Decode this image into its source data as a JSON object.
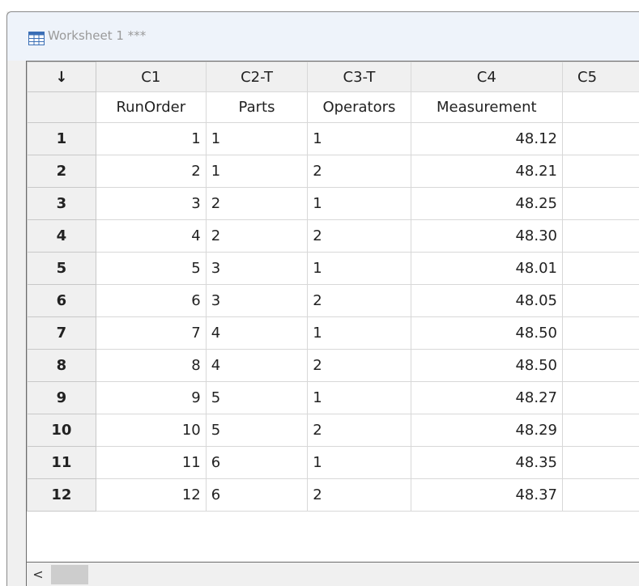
{
  "window": {
    "title": "Worksheet 1 ***"
  },
  "columns": [
    {
      "id": "C1",
      "name": "RunOrder"
    },
    {
      "id": "C2-T",
      "name": "Parts"
    },
    {
      "id": "C3-T",
      "name": "Operators"
    },
    {
      "id": "C4",
      "name": "Measurement"
    },
    {
      "id": "C5",
      "name": ""
    }
  ],
  "corner_icon": "down-arrow-icon",
  "corner_glyph": "↓",
  "rows": [
    {
      "n": "1",
      "run": "1",
      "part": "1",
      "op": "1",
      "meas": "48.12"
    },
    {
      "n": "2",
      "run": "2",
      "part": "1",
      "op": "2",
      "meas": "48.21"
    },
    {
      "n": "3",
      "run": "3",
      "part": "2",
      "op": "1",
      "meas": "48.25"
    },
    {
      "n": "4",
      "run": "4",
      "part": "2",
      "op": "2",
      "meas": "48.30"
    },
    {
      "n": "5",
      "run": "5",
      "part": "3",
      "op": "1",
      "meas": "48.01"
    },
    {
      "n": "6",
      "run": "6",
      "part": "3",
      "op": "2",
      "meas": "48.05"
    },
    {
      "n": "7",
      "run": "7",
      "part": "4",
      "op": "1",
      "meas": "48.50"
    },
    {
      "n": "8",
      "run": "8",
      "part": "4",
      "op": "2",
      "meas": "48.50"
    },
    {
      "n": "9",
      "run": "9",
      "part": "5",
      "op": "1",
      "meas": "48.27"
    },
    {
      "n": "10",
      "run": "10",
      "part": "5",
      "op": "2",
      "meas": "48.29"
    },
    {
      "n": "11",
      "run": "11",
      "part": "6",
      "op": "1",
      "meas": "48.35"
    },
    {
      "n": "12",
      "run": "12",
      "part": "6",
      "op": "2",
      "meas": "48.37"
    }
  ],
  "scrollbar": {
    "left_arrow": "<"
  }
}
